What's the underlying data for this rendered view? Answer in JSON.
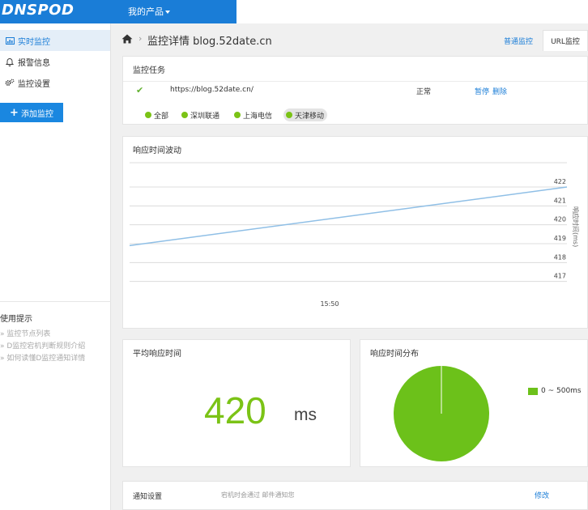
{
  "header": {
    "logo": "DNSPOD",
    "products_menu": "我的产品"
  },
  "sidebar": {
    "items": [
      {
        "label": "实时监控",
        "icon": "chart-icon",
        "active": true
      },
      {
        "label": "报警信息",
        "icon": "bell-icon",
        "active": false
      },
      {
        "label": "监控设置",
        "icon": "gears-icon",
        "active": false
      }
    ],
    "add_button": "添加监控",
    "tips_title": "使用提示",
    "tips": [
      "» 监控节点列表",
      "» D监控宕机判断规则介绍",
      "» 如何读懂D监控通知详情"
    ]
  },
  "breadcrumb": {
    "title": "监控详情 blog.52date.cn",
    "tabs": [
      "普通监控",
      "URL监控"
    ]
  },
  "task": {
    "title": "监控任务",
    "url": "https://blog.52date.cn/",
    "status": "正常",
    "actions": [
      "暂停",
      "删除"
    ],
    "filters": [
      "全部",
      "深圳联通",
      "上海电信",
      "天津移动"
    ],
    "active_filter": "天津移动"
  },
  "response_chart": {
    "title": "响应时间波动",
    "ylabel": "响应时间(ms)"
  },
  "chart_data": {
    "type": "line",
    "title": "响应时间波动",
    "xlabel": "",
    "ylabel": "响应时间(ms)",
    "x_tick_labels": [
      "15:50"
    ],
    "y_ticks": [
      417,
      418,
      419,
      420,
      421,
      422
    ],
    "ylim": [
      416.3,
      422.3
    ],
    "y_axis_side": "right",
    "series": [
      {
        "values": [
          418.9,
          422.0
        ]
      }
    ]
  },
  "average": {
    "title": "平均响应时间",
    "value": "420",
    "unit": "ms"
  },
  "distribution": {
    "title": "响应时间分布",
    "legend": "0 ~ 500ms",
    "color": "#6cc11a",
    "share": 1.0
  },
  "notify": {
    "title": "通知设置",
    "text": "宕机时会通过 邮件通知您",
    "edit": "修改"
  },
  "colors": {
    "accent": "#1a7dd7",
    "green": "#7bc316",
    "line": "#8fbfe6"
  }
}
